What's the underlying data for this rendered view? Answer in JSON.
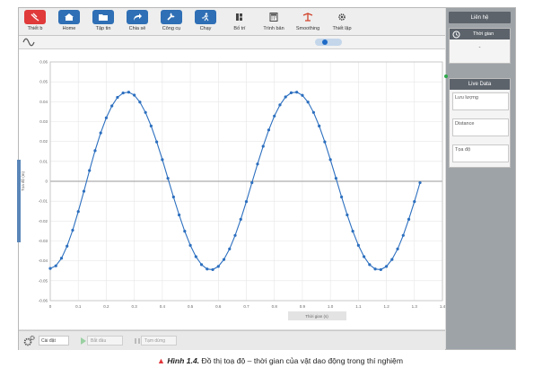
{
  "toolbar": {
    "items": [
      {
        "label": "Thiết b",
        "icon": "plug-icon"
      },
      {
        "label": "Home",
        "icon": "home-icon"
      },
      {
        "label": "Tập tin",
        "icon": "folder-icon"
      },
      {
        "label": "Chia sẻ",
        "icon": "share-icon"
      },
      {
        "label": "Công cụ",
        "icon": "wrench-icon"
      },
      {
        "label": "Chạy",
        "icon": "run-icon"
      },
      {
        "label": "Bố trí",
        "icon": "layout-icon"
      },
      {
        "label": "Trình bản",
        "icon": "calculator-icon"
      },
      {
        "label": "Smoothing",
        "icon": "smoothing-icon"
      },
      {
        "label": "Thiết lập",
        "icon": "gear-icon"
      }
    ]
  },
  "right_panel": {
    "contact_label": "Liên hệ",
    "time_header": "Thời gian",
    "time_value": "-",
    "live_data_header": "Live Data",
    "fields": [
      "Lưu lượng",
      "Distance",
      "Tọa độ"
    ]
  },
  "bottom": {
    "field_value": "Cài đặt",
    "start_label": "Bắt đầu",
    "stop_label": "Tạm dừng"
  },
  "caption": {
    "prefix": "Hình 1.4.",
    "text": " Đồ thị toạ độ – thời gian của vật dao động trong thí nghiệm"
  },
  "chart_data": {
    "type": "line",
    "xlabel": "Thời gian (s)",
    "ylabel": "Tọa độ (m)",
    "xlim": [
      0,
      1.4
    ],
    "ylim": [
      -0.06,
      0.06
    ],
    "xticks": [
      "0",
      "0.1",
      "0.2",
      "0.3",
      "0.4",
      "0.5",
      "0.6",
      "0.7",
      "0.8",
      "0.9",
      "1.0",
      "1.1",
      "1.2",
      "1.3",
      "1.4"
    ],
    "yticks": [
      "0.06",
      "0.05",
      "0.04",
      "0.03",
      "0.02",
      "0.01",
      "0",
      "-0.01",
      "-0.02",
      "-0.03",
      "-0.04",
      "-0.05",
      "-0.06"
    ],
    "grid": true,
    "color": "#2c6fbf",
    "x": [
      0.0,
      0.02,
      0.04,
      0.06,
      0.08,
      0.1,
      0.12,
      0.14,
      0.16,
      0.18,
      0.2,
      0.22,
      0.24,
      0.26,
      0.28,
      0.3,
      0.32,
      0.34,
      0.36,
      0.38,
      0.4,
      0.42,
      0.44,
      0.46,
      0.48,
      0.5,
      0.52,
      0.54,
      0.56,
      0.58,
      0.6,
      0.62,
      0.64,
      0.66,
      0.68,
      0.7,
      0.72,
      0.74,
      0.76,
      0.78,
      0.8,
      0.82,
      0.84,
      0.86,
      0.88,
      0.9,
      0.92,
      0.94,
      0.96,
      0.98,
      1.0,
      1.02,
      1.04,
      1.06,
      1.08,
      1.1,
      1.12,
      1.14,
      1.16,
      1.18,
      1.2,
      1.22,
      1.24,
      1.26,
      1.28,
      1.3,
      1.32
    ],
    "y": [
      -0.0438,
      -0.0425,
      -0.0387,
      -0.0326,
      -0.0246,
      -0.0152,
      -0.005,
      0.0054,
      0.0154,
      0.0243,
      0.0319,
      0.0379,
      0.0422,
      0.0444,
      0.0448,
      0.0433,
      0.0398,
      0.0346,
      0.0278,
      0.0198,
      0.0109,
      0.0015,
      -0.0079,
      -0.0169,
      -0.0251,
      -0.0322,
      -0.0379,
      -0.0419,
      -0.0441,
      -0.0444,
      -0.0428,
      -0.0393,
      -0.034,
      -0.0272,
      -0.0191,
      -0.0102,
      -0.0007,
      0.0087,
      0.0176,
      0.0258,
      0.0328,
      0.0384,
      0.0424,
      0.0445,
      0.0448,
      0.0432,
      0.0398,
      0.0346,
      0.0278,
      0.0198,
      0.0109,
      0.0015,
      -0.0079,
      -0.0169,
      -0.0251,
      -0.0322,
      -0.0379,
      -0.0419,
      -0.0441,
      -0.0444,
      -0.0428,
      -0.0393,
      -0.034,
      -0.0272,
      -0.0191,
      -0.0102,
      -0.0007
    ]
  }
}
